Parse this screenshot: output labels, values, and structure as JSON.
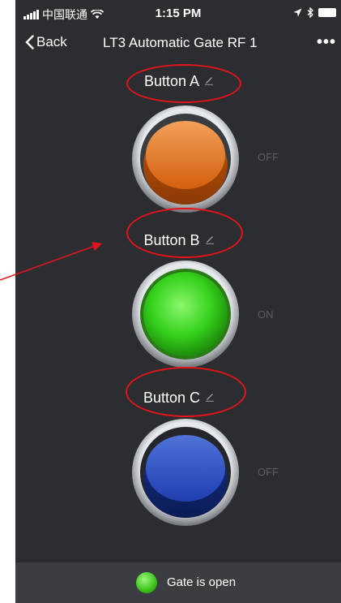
{
  "status_bar": {
    "carrier": "中国联通",
    "time": "1:15 PM"
  },
  "nav": {
    "back_label": "Back",
    "title": "LT3  Automatic Gate RF 1",
    "more_label": "•••"
  },
  "buttons": [
    {
      "label": "Button A",
      "state": "OFF",
      "color": "#e06a12"
    },
    {
      "label": "Button B",
      "state": "ON",
      "color": "#35d11c"
    },
    {
      "label": "Button C",
      "state": "OFF",
      "color": "#1f3fb0"
    }
  ],
  "footer": {
    "status_text": "Gate is open",
    "indicator_color": "#39c21a"
  },
  "colors": {
    "background": "#2b2d30",
    "annotation_red": "#e3141b"
  }
}
